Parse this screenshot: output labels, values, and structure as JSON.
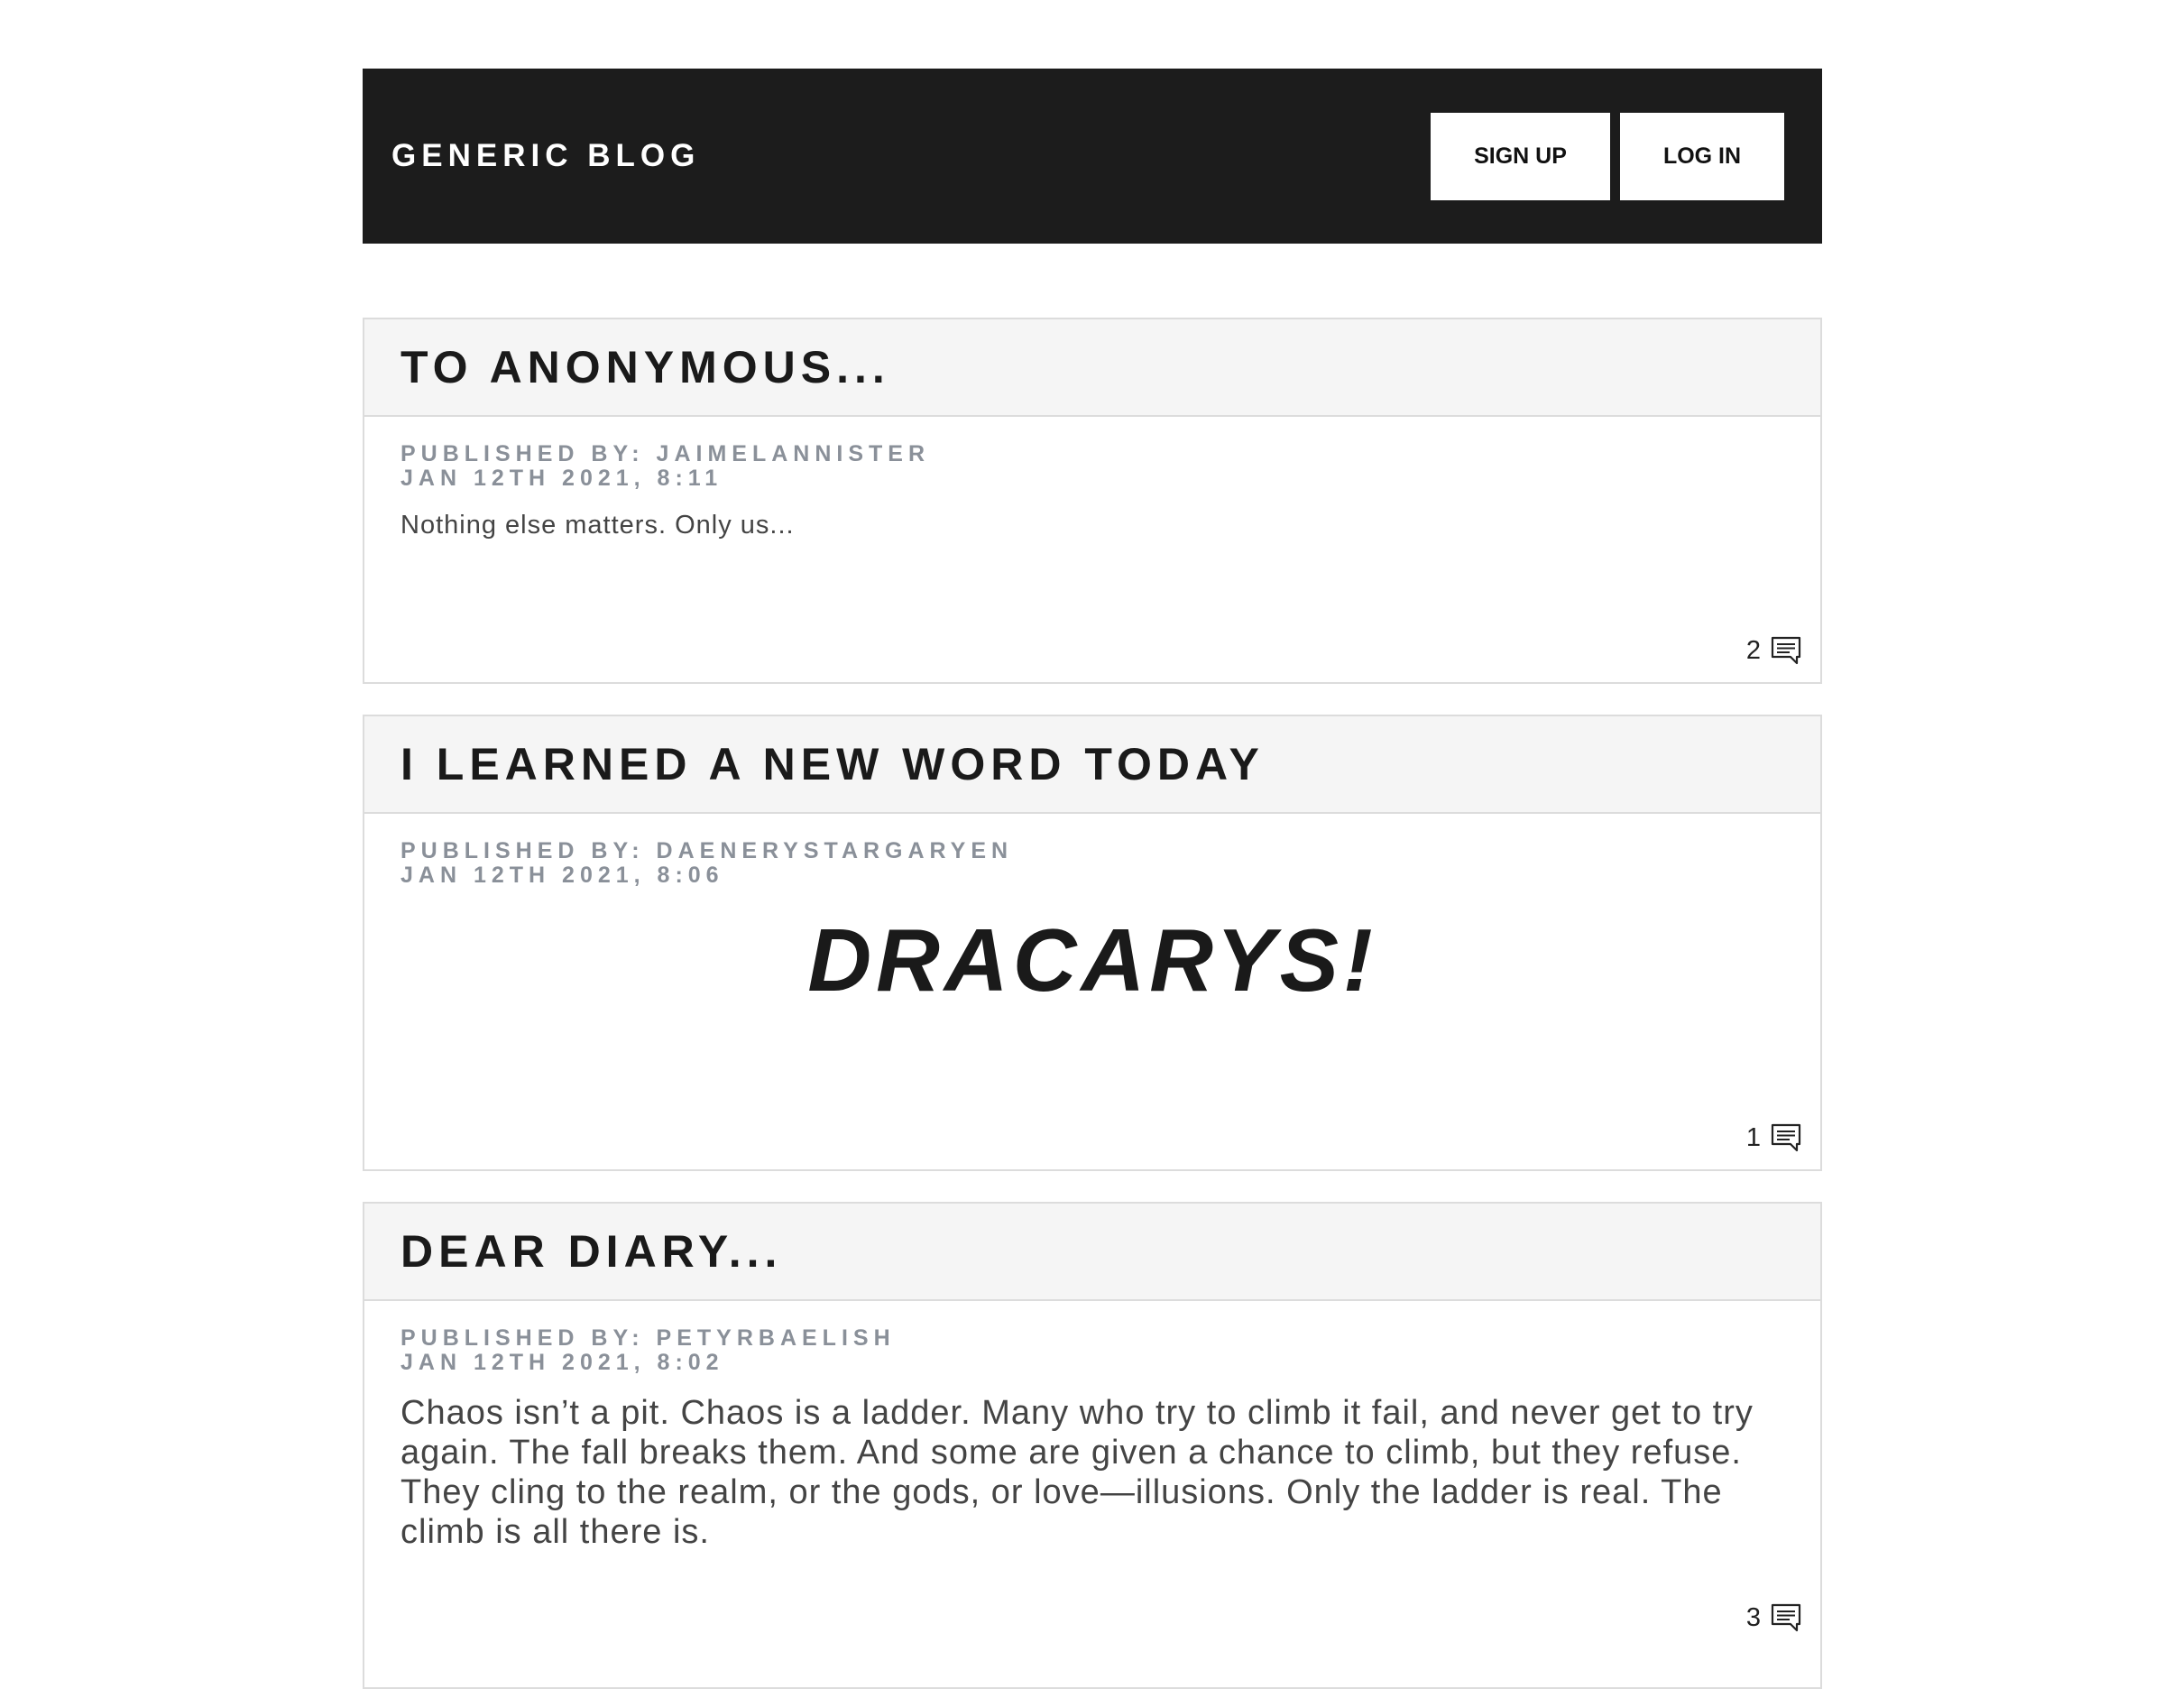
{
  "navbar": {
    "brand": "GENERIC BLOG",
    "signup_label": "SIGN UP",
    "login_label": "LOG IN"
  },
  "posts": [
    {
      "title": "TO ANONYMOUS...",
      "published_by": "PUBLISHED BY: JAIMELANNISTER",
      "date": "JAN 12TH 2021, 8:11",
      "content": "Nothing else matters. Only us...",
      "comment_count": "2"
    },
    {
      "title": "I LEARNED A NEW WORD TODAY",
      "published_by": "PUBLISHED BY: DAENERYSTARGARYEN",
      "date": "JAN 12TH 2021, 8:06",
      "content": "DRACARYS!",
      "comment_count": "1"
    },
    {
      "title": "DEAR DIARY...",
      "published_by": "PUBLISHED BY: PETYRBAELISH",
      "date": "JAN 12TH 2021, 8:02",
      "content": "Chaos isn’t a pit. Chaos is a ladder. Many who try to climb it fail, and never get to try again. The fall breaks them. And some are given a chance to climb, but they refuse. They cling to the realm, or the gods, or love—illusions. Only the ladder is real. The climb is all there is.",
      "comment_count": "3"
    }
  ],
  "icons": {
    "comment": "comment-icon"
  }
}
